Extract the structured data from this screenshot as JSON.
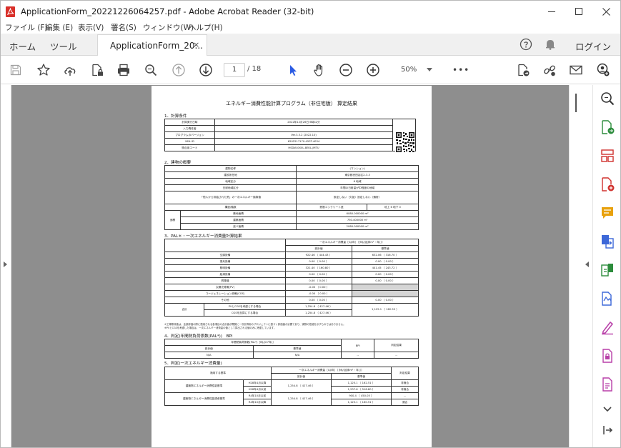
{
  "window": {
    "title": "ApplicationForm_20221226064257.pdf - Adobe Acrobat Reader (32-bit)",
    "minimize": "—",
    "maximize": "☐",
    "close": "✕"
  },
  "menu": [
    "ファイル (F)",
    "編集 (E)",
    "表示(V)",
    "署名(S)",
    "ウィンドウ(W)",
    "ヘルプ(H)"
  ],
  "tabs": {
    "home": "ホーム",
    "tools": "ツール",
    "document": "ApplicationForm_20...",
    "close": "×",
    "login": "ログイン"
  },
  "toolbar": {
    "page_current": "1",
    "page_total": "/ 18",
    "zoom": "50%",
    "more": "•••"
  },
  "document": {
    "title": "エネルギー消費性能計算プログラム（非住宅版） 算定結果",
    "s1": {
      "heading": "1．計算条件",
      "rows": [
        [
          "計算実行日時",
          "2022年12月26日 6時42分"
        ],
        [
          "入力責任者",
          ""
        ],
        [
          "プログラムのバージョン",
          "Ver.3.3.2 (2022.10)"
        ],
        [
          "XML ID",
          "6202217170-453T-4034"
        ],
        [
          "照合用コード",
          "HSDW-0X0L-8EKL-JMTU"
        ]
      ]
    },
    "s2": {
      "heading": "2．建物の概要",
      "rows": [
        [
          "建物名称",
          "(マンション)"
        ],
        [
          "建設所在地",
          "東京都世田谷区2-3-3"
        ],
        [
          "地域区分",
          "6 地域"
        ],
        [
          "日射地域区分",
          "年間の日射量が中程度の地域"
        ],
        [
          "「他人から供給された熱」の一次エネルギー換算値",
          "設定しない（欠如）設定しない（通常）"
        ]
      ],
      "structure_label": "構造/階数",
      "structure_values": [
        "鉄筋コンクリート造",
        "地上 6 地下 0"
      ],
      "area_label": "面積",
      "areas": [
        [
          "敷地面積",
          "6080.000000 m²"
        ],
        [
          "建築面積",
          "750.400000 m²"
        ],
        [
          "延べ面積",
          "2080.000000 m²"
        ]
      ]
    },
    "s3": {
      "heading": "3．PAL＊・一次エネルギー消費量計算結果",
      "header": "一次エネルギー消費量［GJ/年］（［MJ/(延床m²・年)］）",
      "col_design": "設計値",
      "col_standard": "基準値",
      "rows": [
        [
          "空調設備",
          "922.46 （ 444.43 ）",
          "632.06 （ 316.70 ）"
        ],
        [
          "換気設備",
          "0.00 （ 0.00 ）",
          "0.00 （ 0.00 ）"
        ],
        [
          "照明設備",
          "321.40 （ 160.80 ）",
          "441.45 （ 243.72 ）"
        ],
        [
          "給湯設備",
          "0.00 （ 0.00 ）",
          "0.00 （ 0.00 ）"
        ],
        [
          "昇降機",
          "0.00 （ 0.00 ）",
          "0.00 （ 0.00 ）"
        ],
        [
          "太陽光発電(PV)",
          "-0.00 （ 0.00 ）",
          ""
        ],
        [
          "コージェネレーション設備(CGS)",
          "-0.00 （ 0.00 ）",
          ""
        ],
        [
          "その他",
          "0.00 （ 0.00 ）",
          "0.00 （ 0.00 ）"
        ]
      ],
      "total_label": "合計",
      "total_rows": [
        [
          "PVとCGSを考慮とする場合",
          "1,254.8 （ 427.46 ）"
        ],
        [
          "CGSを加算にする場合",
          "1,254.8 （ 427.46 ）"
        ]
      ],
      "total_standard": "1,125.1 （ 162.55 ）",
      "notes": [
        "※工場等評価は、全部評価の際に適用される各項目の合計値が開発に一次計算用のプロジェクトに基づく評価値が必要であり、実際の性能を示すものではありません。",
        "※PVとCGSを考慮した場合は、一次エネルギー消費量の値として算出される値のみに考慮しています。"
      ]
    },
    "s4": {
      "heading": "4．判定(年間熱負荷係数(PAL*))　BPI",
      "header": "年間熱負荷係数(PAL*)［MJ/(m²年)］",
      "cols": [
        "設計値",
        "基準値",
        "BPI",
        "判定結果"
      ],
      "values": [
        "N/A",
        "N/A",
        "--",
        "--"
      ]
    },
    "s5": {
      "heading": "5．判定(一次エネルギー消費量)",
      "header": "一次エネルギー消費量［GJ/年］（［MJ/(延床m²・年)］）",
      "col_target": "適用する基準",
      "col_design": "設計値",
      "col_standard": "基準値",
      "col_result": "判定結果",
      "row1_label": "建築物エネルギー消費性能基準",
      "row1_sub": [
        "H28年4月以降",
        "H28年4月以前"
      ],
      "row1_design": "1,254.8 （ 427.46 ）",
      "row1_standards": [
        "1,125.1 （ 162.51 ）",
        "1,237.6 （ 518.80 ）"
      ],
      "row1_results": [
        "非適合",
        "非適合"
      ],
      "row2_label": "建築物エネルギー消費性能誘導基準",
      "row2_sub": [
        "R4年10月以前",
        "R4年10月以降"
      ],
      "row2_design": "1,254.8 （ 427.46 ）",
      "row2_standards": [
        "900.4 （ 450.05 ）",
        "1,125.1 （ 160.51 ）"
      ],
      "row2_results": [
        "--",
        "適合"
      ]
    }
  },
  "colors": {
    "accent": "#2b5be3",
    "rightpanel_icons": "#d0312d"
  }
}
